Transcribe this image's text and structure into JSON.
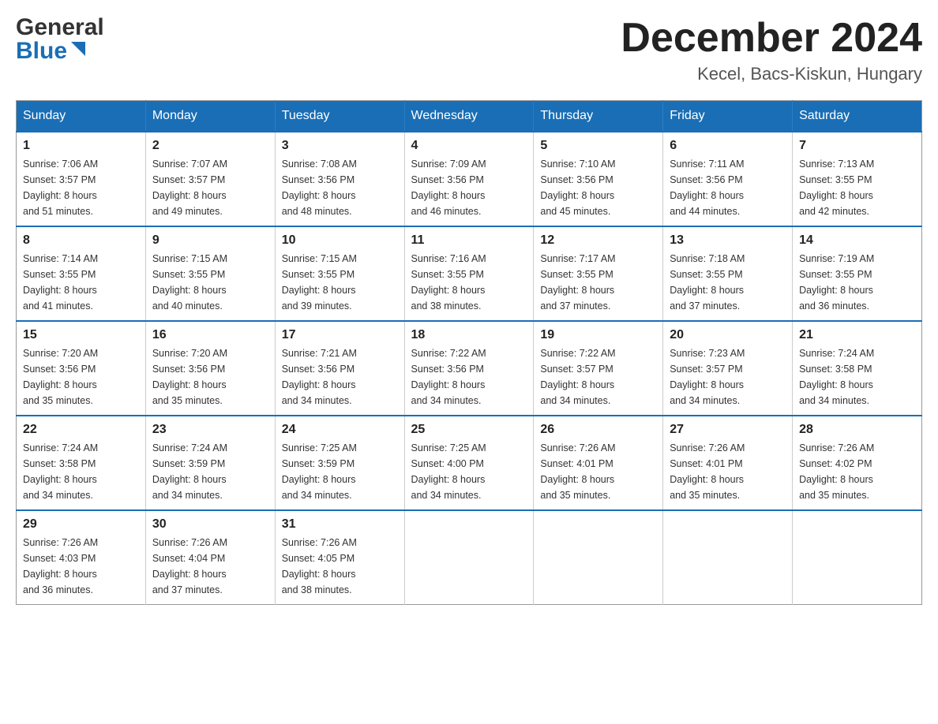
{
  "header": {
    "logo_general": "General",
    "logo_blue": "Blue",
    "month_title": "December 2024",
    "location": "Kecel, Bacs-Kiskun, Hungary"
  },
  "days_of_week": [
    "Sunday",
    "Monday",
    "Tuesday",
    "Wednesday",
    "Thursday",
    "Friday",
    "Saturday"
  ],
  "weeks": [
    [
      {
        "day": "1",
        "sunrise": "7:06 AM",
        "sunset": "3:57 PM",
        "daylight": "8 hours and 51 minutes."
      },
      {
        "day": "2",
        "sunrise": "7:07 AM",
        "sunset": "3:57 PM",
        "daylight": "8 hours and 49 minutes."
      },
      {
        "day": "3",
        "sunrise": "7:08 AM",
        "sunset": "3:56 PM",
        "daylight": "8 hours and 48 minutes."
      },
      {
        "day": "4",
        "sunrise": "7:09 AM",
        "sunset": "3:56 PM",
        "daylight": "8 hours and 46 minutes."
      },
      {
        "day": "5",
        "sunrise": "7:10 AM",
        "sunset": "3:56 PM",
        "daylight": "8 hours and 45 minutes."
      },
      {
        "day": "6",
        "sunrise": "7:11 AM",
        "sunset": "3:56 PM",
        "daylight": "8 hours and 44 minutes."
      },
      {
        "day": "7",
        "sunrise": "7:13 AM",
        "sunset": "3:55 PM",
        "daylight": "8 hours and 42 minutes."
      }
    ],
    [
      {
        "day": "8",
        "sunrise": "7:14 AM",
        "sunset": "3:55 PM",
        "daylight": "8 hours and 41 minutes."
      },
      {
        "day": "9",
        "sunrise": "7:15 AM",
        "sunset": "3:55 PM",
        "daylight": "8 hours and 40 minutes."
      },
      {
        "day": "10",
        "sunrise": "7:15 AM",
        "sunset": "3:55 PM",
        "daylight": "8 hours and 39 minutes."
      },
      {
        "day": "11",
        "sunrise": "7:16 AM",
        "sunset": "3:55 PM",
        "daylight": "8 hours and 38 minutes."
      },
      {
        "day": "12",
        "sunrise": "7:17 AM",
        "sunset": "3:55 PM",
        "daylight": "8 hours and 37 minutes."
      },
      {
        "day": "13",
        "sunrise": "7:18 AM",
        "sunset": "3:55 PM",
        "daylight": "8 hours and 37 minutes."
      },
      {
        "day": "14",
        "sunrise": "7:19 AM",
        "sunset": "3:55 PM",
        "daylight": "8 hours and 36 minutes."
      }
    ],
    [
      {
        "day": "15",
        "sunrise": "7:20 AM",
        "sunset": "3:56 PM",
        "daylight": "8 hours and 35 minutes."
      },
      {
        "day": "16",
        "sunrise": "7:20 AM",
        "sunset": "3:56 PM",
        "daylight": "8 hours and 35 minutes."
      },
      {
        "day": "17",
        "sunrise": "7:21 AM",
        "sunset": "3:56 PM",
        "daylight": "8 hours and 34 minutes."
      },
      {
        "day": "18",
        "sunrise": "7:22 AM",
        "sunset": "3:56 PM",
        "daylight": "8 hours and 34 minutes."
      },
      {
        "day": "19",
        "sunrise": "7:22 AM",
        "sunset": "3:57 PM",
        "daylight": "8 hours and 34 minutes."
      },
      {
        "day": "20",
        "sunrise": "7:23 AM",
        "sunset": "3:57 PM",
        "daylight": "8 hours and 34 minutes."
      },
      {
        "day": "21",
        "sunrise": "7:24 AM",
        "sunset": "3:58 PM",
        "daylight": "8 hours and 34 minutes."
      }
    ],
    [
      {
        "day": "22",
        "sunrise": "7:24 AM",
        "sunset": "3:58 PM",
        "daylight": "8 hours and 34 minutes."
      },
      {
        "day": "23",
        "sunrise": "7:24 AM",
        "sunset": "3:59 PM",
        "daylight": "8 hours and 34 minutes."
      },
      {
        "day": "24",
        "sunrise": "7:25 AM",
        "sunset": "3:59 PM",
        "daylight": "8 hours and 34 minutes."
      },
      {
        "day": "25",
        "sunrise": "7:25 AM",
        "sunset": "4:00 PM",
        "daylight": "8 hours and 34 minutes."
      },
      {
        "day": "26",
        "sunrise": "7:26 AM",
        "sunset": "4:01 PM",
        "daylight": "8 hours and 35 minutes."
      },
      {
        "day": "27",
        "sunrise": "7:26 AM",
        "sunset": "4:01 PM",
        "daylight": "8 hours and 35 minutes."
      },
      {
        "day": "28",
        "sunrise": "7:26 AM",
        "sunset": "4:02 PM",
        "daylight": "8 hours and 35 minutes."
      }
    ],
    [
      {
        "day": "29",
        "sunrise": "7:26 AM",
        "sunset": "4:03 PM",
        "daylight": "8 hours and 36 minutes."
      },
      {
        "day": "30",
        "sunrise": "7:26 AM",
        "sunset": "4:04 PM",
        "daylight": "8 hours and 37 minutes."
      },
      {
        "day": "31",
        "sunrise": "7:26 AM",
        "sunset": "4:05 PM",
        "daylight": "8 hours and 38 minutes."
      },
      null,
      null,
      null,
      null
    ]
  ],
  "labels": {
    "sunrise": "Sunrise:",
    "sunset": "Sunset:",
    "daylight": "Daylight:"
  }
}
